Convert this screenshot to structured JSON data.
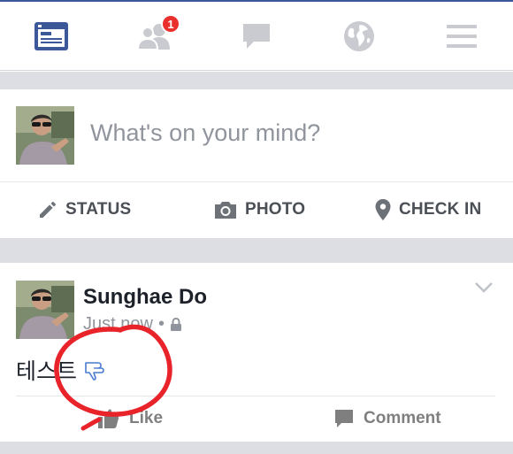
{
  "navbar": {
    "items": [
      {
        "name": "news-feed",
        "icon": "news-feed-icon",
        "active": true
      },
      {
        "name": "friend-requests",
        "icon": "friends-icon",
        "badge": "1"
      },
      {
        "name": "messages",
        "icon": "chat-bubble-icon"
      },
      {
        "name": "notifications",
        "icon": "globe-icon"
      },
      {
        "name": "more",
        "icon": "hamburger-menu-icon"
      }
    ]
  },
  "composer": {
    "placeholder": "What's on your mind?",
    "actions": [
      {
        "label": "STATUS",
        "icon": "pencil-icon"
      },
      {
        "label": "PHOTO",
        "icon": "camera-icon"
      },
      {
        "label": "CHECK IN",
        "icon": "location-pin-icon"
      }
    ]
  },
  "post": {
    "author": "Sunghae Do",
    "timestamp": "Just now",
    "separator": "•",
    "privacy_icon": "lock-icon",
    "text": "테스트",
    "emoji_icon": "thumbs-down-hand-icon",
    "actions": [
      {
        "label": "Like",
        "icon": "thumbs-up-icon"
      },
      {
        "label": "Comment",
        "icon": "comment-icon"
      }
    ]
  },
  "colors": {
    "brand": "#3b5998",
    "badge": "#e9302d",
    "inactive_icon": "#c9cbd0",
    "annotation": "#e8232a"
  }
}
